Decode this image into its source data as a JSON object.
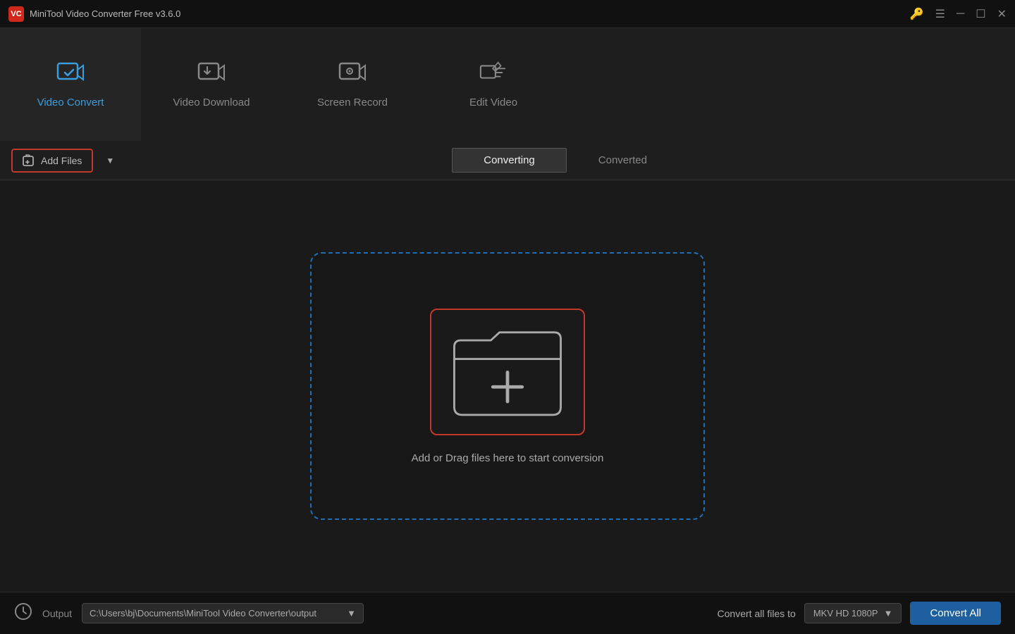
{
  "app": {
    "title": "MiniTool Video Converter Free v3.6.0",
    "logo_text": "VC"
  },
  "titlebar": {
    "key_icon": "🔑",
    "menu_icon": "☰",
    "minimize_icon": "─",
    "maximize_icon": "☐",
    "close_icon": "✕"
  },
  "nav": {
    "tabs": [
      {
        "id": "video-convert",
        "label": "Video Convert",
        "active": true
      },
      {
        "id": "video-download",
        "label": "Video Download",
        "active": false
      },
      {
        "id": "screen-record",
        "label": "Screen Record",
        "active": false
      },
      {
        "id": "edit-video",
        "label": "Edit Video",
        "active": false
      }
    ]
  },
  "toolbar": {
    "add_files_label": "Add Files",
    "sub_tabs": [
      {
        "id": "converting",
        "label": "Converting",
        "active": true
      },
      {
        "id": "converted",
        "label": "Converted",
        "active": false
      }
    ]
  },
  "dropzone": {
    "hint_text": "Add or Drag files here to start conversion"
  },
  "footer": {
    "output_label": "Output",
    "output_path": "C:\\Users\\bj\\Documents\\MiniTool Video Converter\\output",
    "convert_all_label": "Convert all files to",
    "format": "MKV HD 1080P",
    "convert_all_btn": "Convert All"
  }
}
